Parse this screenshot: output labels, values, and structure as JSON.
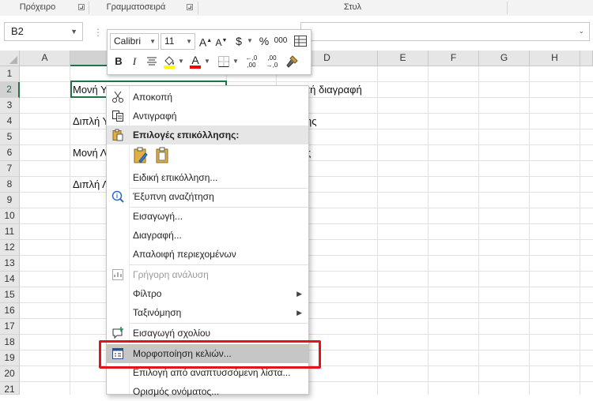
{
  "ribbon": {
    "groups": [
      {
        "label": "Πρόχειρο"
      },
      {
        "label": "Γραμματοσειρά"
      },
      {
        "label": "Στυλ"
      }
    ]
  },
  "formula_bar": {
    "name_box": "B2",
    "formula": ""
  },
  "grid": {
    "columns": [
      "A",
      "B",
      "C",
      "D",
      "E",
      "F",
      "G",
      "H"
    ],
    "rows": [
      "1",
      "2",
      "3",
      "4",
      "5",
      "6",
      "7",
      "8",
      "9",
      "10",
      "11",
      "12",
      "13",
      "14",
      "15",
      "16",
      "17",
      "18",
      "19",
      "20",
      "21"
    ],
    "cells": {
      "b2": "Μονή Υ",
      "b4": "Διπλή Υ",
      "b6": "Μονή Λ",
      "b8": "Διπλή Λ",
      "d2": "τή διαγραφή",
      "d4": "ης",
      "d6": "ς"
    }
  },
  "mini_toolbar": {
    "font_name": "Calibri",
    "font_size": "11",
    "grow_font": "A",
    "shrink_font": "A",
    "currency": "$",
    "percent": "%",
    "comma": "000",
    "bold": "B",
    "italic": "I",
    "font_color": "A",
    "increase_decimal": "←,0 ,00",
    "decrease_decimal": ",00 →,0",
    "highlight_color": "#ffff00",
    "font_color_bar": "#ff0000"
  },
  "context_menu": {
    "cut": "Αποκοπή",
    "copy": "Αντιγραφή",
    "paste_options": "Επιλογές επικόλλησης:",
    "paste_special": "Ειδική επικόλληση...",
    "smart_lookup": "Έξυπνη αναζήτηση",
    "insert": "Εισαγωγή...",
    "delete": "Διαγραφή...",
    "clear_contents": "Απαλοιφή περιεχομένων",
    "quick_analysis": "Γρήγορη ανάλυση",
    "filter": "Φίλτρο",
    "sort": "Ταξινόμηση",
    "insert_comment": "Εισαγωγή σχολίου",
    "format_cells": "Μορφοποίηση κελιών...",
    "pick_from_list": "Επιλογή από αναπτυσσόμενη λίστα...",
    "define_name": "Ορισμός ονόματος..."
  },
  "colors": {
    "excel_green": "#217346",
    "highlight_red": "#e0141e"
  }
}
